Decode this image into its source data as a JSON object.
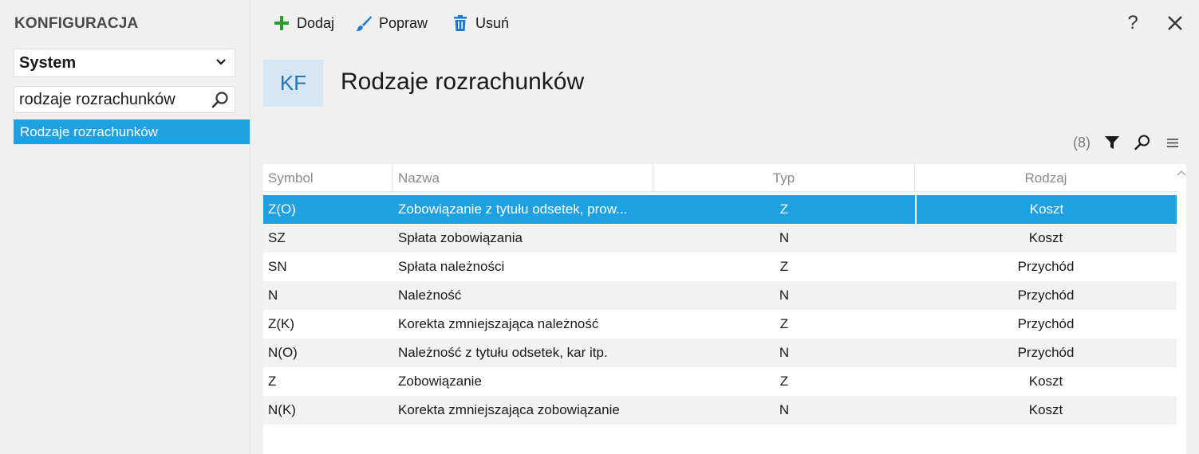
{
  "sidebar": {
    "title": "KONFIGURACJA",
    "module": "System",
    "search_value": "rodzaje rozrachunków",
    "results": [
      "Rodzaje rozrachunków"
    ]
  },
  "toolbar": {
    "add_label": "Dodaj",
    "edit_label": "Popraw",
    "delete_label": "Usuń",
    "help_label": "?"
  },
  "header": {
    "badge": "KF",
    "title": "Rodzaje rozrachunków"
  },
  "list": {
    "count": "(8)",
    "columns": {
      "symbol": "Symbol",
      "name": "Nazwa",
      "type": "Typ",
      "kind": "Rodzaj"
    },
    "rows": [
      {
        "symbol": "Z(O)",
        "name": "Zobowiązanie z tytułu odsetek, prow...",
        "type": "Z",
        "kind": "Koszt"
      },
      {
        "symbol": "SZ",
        "name": "Spłata zobowiązania",
        "type": "N",
        "kind": "Koszt"
      },
      {
        "symbol": "SN",
        "name": "Spłata należności",
        "type": "Z",
        "kind": "Przychód"
      },
      {
        "symbol": "N",
        "name": "Należność",
        "type": "N",
        "kind": "Przychód"
      },
      {
        "symbol": "Z(K)",
        "name": "Korekta zmniejszająca należność",
        "type": "Z",
        "kind": "Przychód"
      },
      {
        "symbol": "N(O)",
        "name": "Należność z tytułu odsetek, kar itp.",
        "type": "N",
        "kind": "Przychód"
      },
      {
        "symbol": "Z",
        "name": "Zobowiązanie",
        "type": "Z",
        "kind": "Koszt"
      },
      {
        "symbol": "N(K)",
        "name": "Korekta zmniejszająca zobowiązanie",
        "type": "N",
        "kind": "Koszt"
      }
    ]
  },
  "colors": {
    "accent": "#1ea1e3",
    "badge_bg": "#d6e7f3",
    "badge_fg": "#2075b8",
    "add_icon": "#2e9b2e",
    "edit_icon": "#1e7bd0",
    "delete_icon": "#1e7bd0"
  }
}
